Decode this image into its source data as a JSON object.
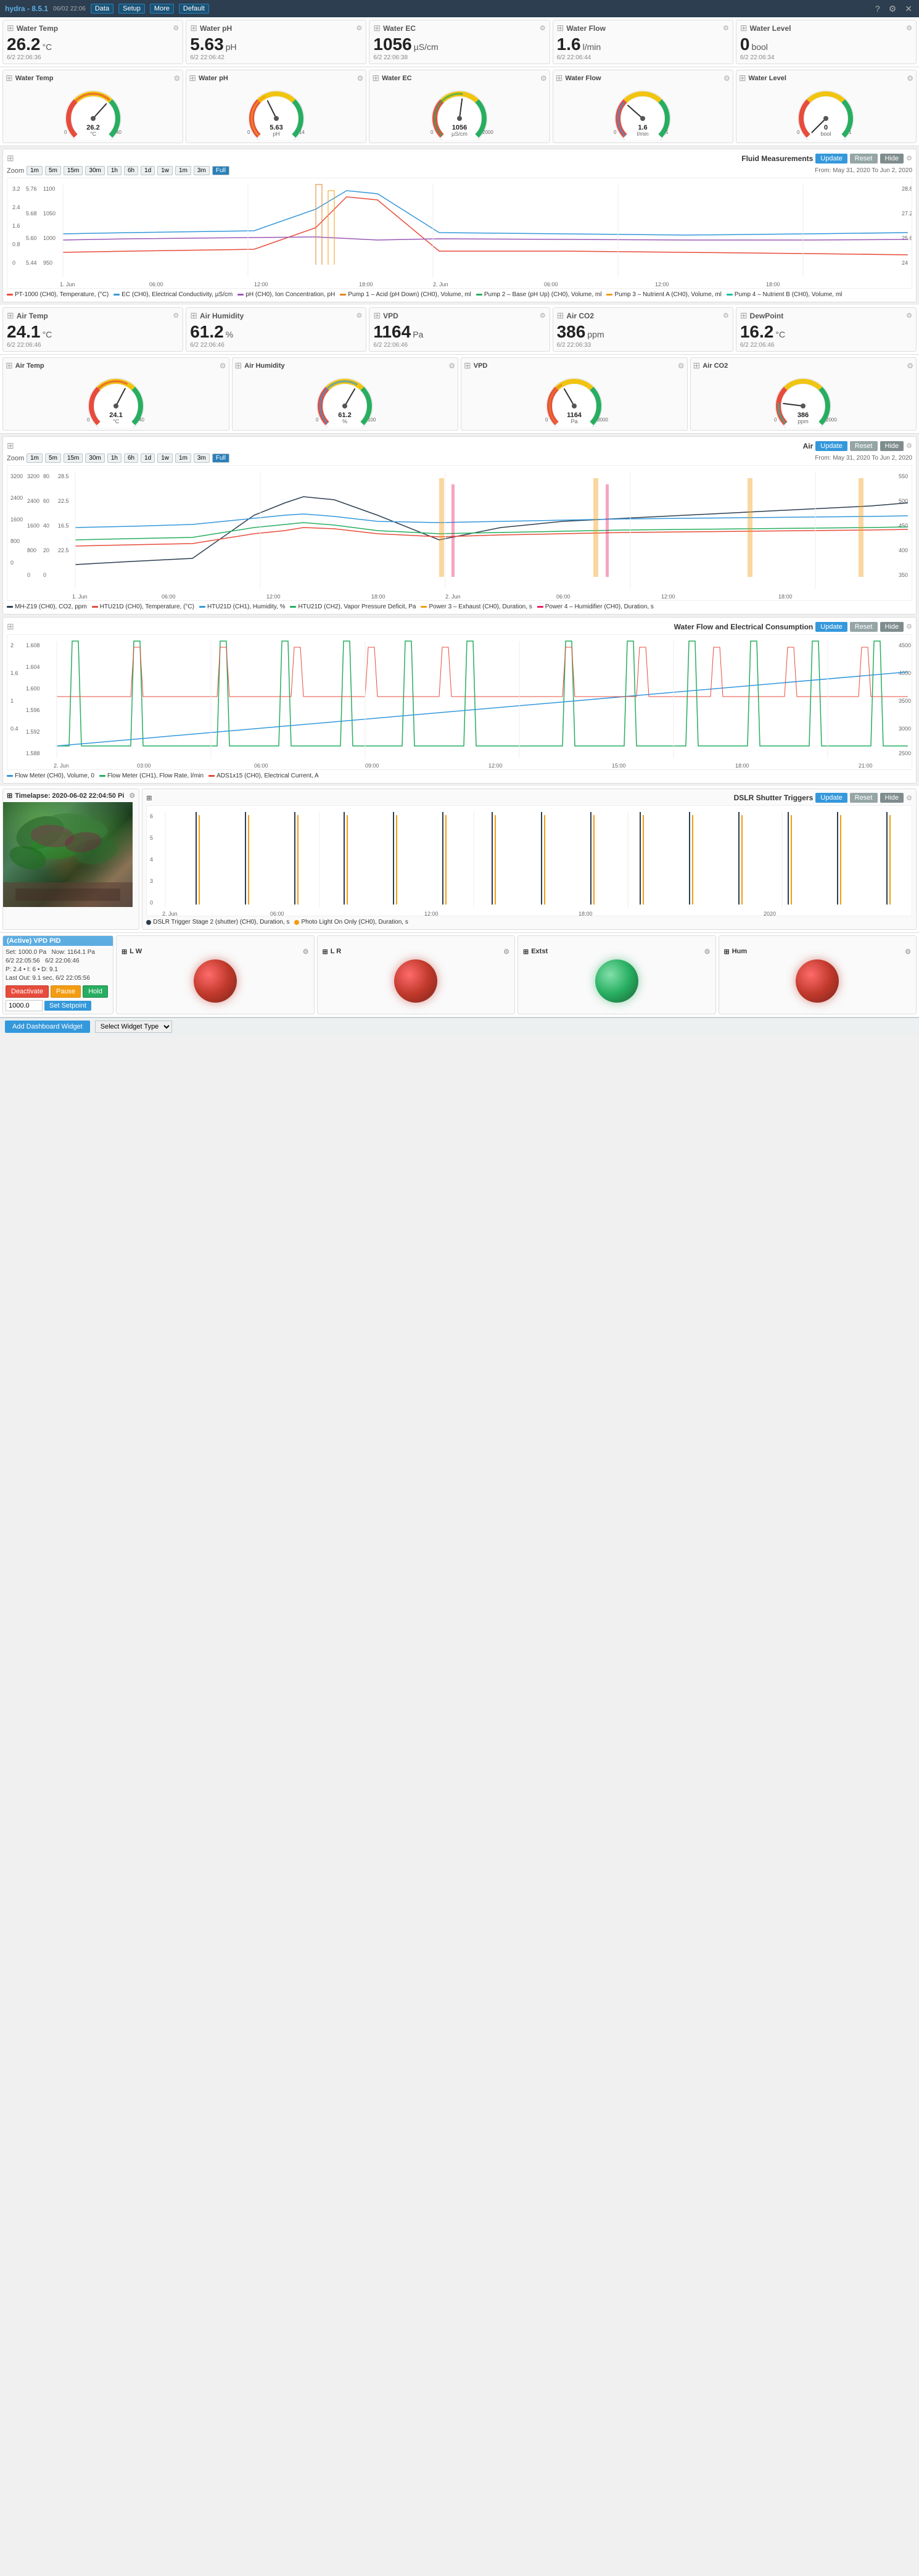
{
  "nav": {
    "brand": "hydra - 8.5.1",
    "date": "06/02 22:06",
    "data_label": "Data",
    "setup_label": "Setup",
    "more_label": "More",
    "default_label": "Default",
    "help_icon": "?",
    "settings_icon": "⚙",
    "close_icon": "✕"
  },
  "water_widgets": [
    {
      "title": "Water Temp",
      "value": "26.2",
      "unit": "°C",
      "time": "6/2 22:06:36",
      "min": 0,
      "max": 40,
      "current": 26.2,
      "color": "#e74c3c"
    },
    {
      "title": "Water pH",
      "value": "5.63",
      "unit": "pH",
      "time": "6/2 22:06:42",
      "min": 0,
      "max": 14,
      "current": 5.63,
      "color": "#f39c12"
    },
    {
      "title": "Water EC",
      "value": "1056",
      "unit": "µS/cm",
      "time": "6/2 22:06:38",
      "min": 0,
      "max": 2000,
      "current": 1056,
      "color": "#27ae60"
    },
    {
      "title": "Water Flow",
      "value": "1.6",
      "unit": "l/min",
      "time": "6/2 22:06:44",
      "min": 0,
      "max": 5,
      "current": 1.6,
      "color": "#3498db"
    },
    {
      "title": "Water Level",
      "value": "0",
      "unit": "bool",
      "time": "6/2 22:06:34",
      "min": 0,
      "max": 1,
      "current": 0,
      "color": "#9b59b6"
    }
  ],
  "air_widgets": [
    {
      "title": "Air Temp",
      "value": "24.1",
      "unit": "°C",
      "time": "6/2 22:06:46",
      "min": 0,
      "max": 40,
      "current": 24.1,
      "color": "#e74c3c"
    },
    {
      "title": "Air Humidity",
      "value": "61.2",
      "unit": "%",
      "time": "6/2 22:06:46",
      "min": 0,
      "max": 100,
      "current": 61.2,
      "color": "#3498db"
    },
    {
      "title": "VPD",
      "value": "1164",
      "unit": "Pa",
      "time": "6/2 22:06:46",
      "min": 0,
      "max": 3000,
      "current": 1164,
      "color": "#e67e22"
    },
    {
      "title": "Air CO2",
      "value": "386",
      "unit": "ppm",
      "time": "6/2 22:06:33",
      "min": 0,
      "max": 2000,
      "current": 386,
      "color": "#1abc9c"
    },
    {
      "title": "DewPoint",
      "value": "16.2",
      "unit": "°C",
      "time": "6/2 22:06:46",
      "min": 0,
      "max": 40,
      "current": 16.2,
      "color": "#e74c3c"
    }
  ],
  "fluid_chart": {
    "title": "Fluid Measurements",
    "update_label": "Update",
    "reset_label": "Reset",
    "hide_label": "Hide",
    "zoom_label": "Zoom",
    "zoom_options": [
      "1m",
      "5m",
      "15m",
      "30m",
      "1h",
      "6h",
      "1d",
      "1w",
      "1m",
      "3m",
      "Full"
    ],
    "active_zoom": "Full",
    "from_label": "From:",
    "from_date": "May 31, 2020",
    "to_label": "To:",
    "to_date": "Jun 2, 2020",
    "legend": [
      {
        "color": "#e74c3c",
        "label": "PT-1000 (CH0), Temperature, (°C)"
      },
      {
        "color": "#3498db",
        "label": "EC (CH0), Electrical Conductivity, µS/cm"
      },
      {
        "color": "#9b59b6",
        "label": "pH (CH0), Ion Concentration, pH"
      },
      {
        "color": "#e67e22",
        "label": "Pump 1 – Acid (pH Down) (CH0), Volume, ml"
      },
      {
        "color": "#27ae60",
        "label": "Pump 2 – Base (pH Up) (CH0), Volume, ml"
      },
      {
        "color": "#f39c12",
        "label": "Pump 3 – Nutrient A (CH0), Volume, ml"
      },
      {
        "color": "#1abc9c",
        "label": "Pump 4 – Nutrient B (CH0), Volume, ml"
      }
    ]
  },
  "air_chart": {
    "title": "Air",
    "update_label": "Update",
    "reset_label": "Reset",
    "hide_label": "Hide",
    "zoom_options": [
      "1m",
      "5m",
      "15m",
      "30m",
      "1h",
      "6h",
      "1d",
      "1w",
      "1m",
      "3m",
      "Full"
    ],
    "active_zoom": "Full",
    "from_date": "May 31, 2020",
    "to_date": "Jun 2, 2020",
    "legend": [
      {
        "color": "#2c3e50",
        "label": "MH-Z19 (CH0), CO2, ppm"
      },
      {
        "color": "#e74c3c",
        "label": "HTU21D (CH0), Temperature, (°C)"
      },
      {
        "color": "#3498db",
        "label": "HTU21D (CH1), Humidity, %"
      },
      {
        "color": "#27ae60",
        "label": "HTU21D (CH2), Vapor Pressure Deficit, Pa"
      },
      {
        "color": "#f39c12",
        "label": "Power 3 – Exhaust (CH0), Duration, s"
      },
      {
        "color": "#e91e63",
        "label": "Power 4 – Humidifier (CH0), Duration, s"
      }
    ]
  },
  "water_flow_chart": {
    "title": "Water Flow and Electrical Consumption",
    "update_label": "Update",
    "reset_label": "Reset",
    "hide_label": "Hide",
    "legend": [
      {
        "color": "#3498db",
        "label": "Flow Meter (CH0), Volume, 0"
      },
      {
        "color": "#27ae60",
        "label": "Flow Meter (CH1), Flow Rate, l/min"
      },
      {
        "color": "#e74c3c",
        "label": "ADS1x15 (CH0), Electrical Current, A"
      }
    ]
  },
  "timelapse": {
    "title": "Timelapse: 2020-06-02 22:04:50 Pi",
    "dslr_title": "DSLR Shutter Triggers",
    "update_label": "Update",
    "reset_label": "Reset",
    "hide_label": "Hide",
    "legend": [
      {
        "color": "#2c3e50",
        "label": "DSLR Trigger Stage 2 (shutter) (CH0), Duration, s"
      },
      {
        "color": "#f39c12",
        "label": "Photo Light On Only (CH0), Duration, s"
      }
    ]
  },
  "pid_controller": {
    "title": "(Active) VPD PID",
    "set_label": "Set:",
    "set_value": "1000.0 Pa",
    "now_label": "Now:",
    "now_value": "1164.1 Pa",
    "set_time": "6/2 22:05:56",
    "now_time": "6/2 22:06:46",
    "p_value": "P: 2.4 • I: 6 • D: 9.1",
    "last_out": "Last Out: 9.1 sec, 6/2 22:05:56",
    "deactivate_label": "Deactivate",
    "pause_label": "Pause",
    "hold_label": "Hold",
    "setpoint_value": "1000.0",
    "setpoint_btn_label": "Set Setpoint"
  },
  "light_indicators": [
    {
      "id": "lw",
      "label": "L W",
      "active": true,
      "color": "red"
    },
    {
      "id": "lr",
      "label": "L R",
      "active": true,
      "color": "red"
    },
    {
      "id": "extst",
      "label": "Extst",
      "active": false,
      "color": "red"
    },
    {
      "id": "hum",
      "label": "Hum",
      "active": true,
      "color": "red"
    }
  ],
  "bottom_bar": {
    "add_label": "Add Dashboard Widget",
    "widget_options": [
      "Select Widget Type"
    ]
  }
}
